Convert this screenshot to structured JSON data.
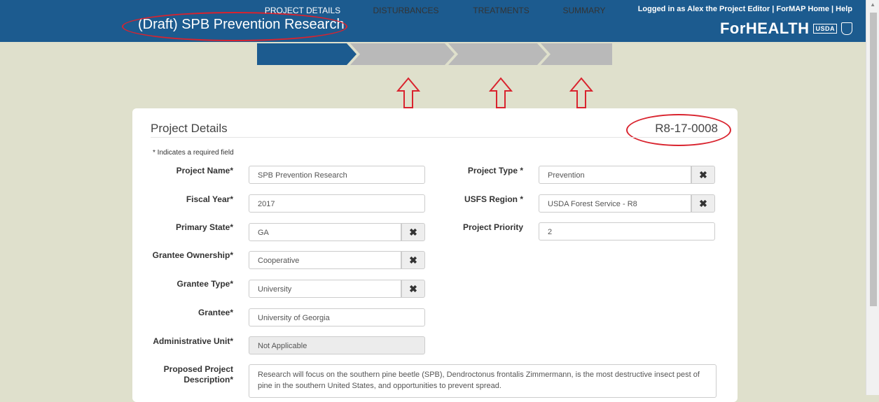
{
  "header": {
    "title": "(Draft) SPB Prevention Research",
    "logged_in": "Logged in as Alex the Project Editor",
    "link_home": "ForMAP Home",
    "link_help": "Help",
    "sep": "|",
    "brand": "ForHEALTH",
    "usda_mark": "USDA"
  },
  "wizard": {
    "steps": [
      {
        "label": "PROJECT DETAILS",
        "active": true
      },
      {
        "label": "DISTURBANCES",
        "active": false
      },
      {
        "label": "TREATMENTS",
        "active": false
      },
      {
        "label": "SUMMARY",
        "active": false
      }
    ]
  },
  "card": {
    "title": "Project Details",
    "project_id": "R8-17-0008",
    "required_note": "* Indicates a required field"
  },
  "form": {
    "project_name": {
      "label": "Project Name*",
      "value": "SPB Prevention Research"
    },
    "fiscal_year": {
      "label": "Fiscal Year*",
      "value": "2017"
    },
    "primary_state": {
      "label": "Primary State*",
      "value": "GA"
    },
    "grantee_ownership": {
      "label": "Grantee Ownership*",
      "value": "Cooperative"
    },
    "grantee_type": {
      "label": "Grantee Type*",
      "value": "University"
    },
    "grantee": {
      "label": "Grantee*",
      "value": "University of Georgia"
    },
    "admin_unit": {
      "label": "Administrative Unit*",
      "value": "Not Applicable"
    },
    "description": {
      "label_line1": "Proposed Project",
      "label_line2": "Description*",
      "value": "Research will focus on the southern pine beetle (SPB), Dendroctonus frontalis Zimmermann, is the most destructive insect pest of pine in the southern United States, and opportunities to prevent spread."
    },
    "project_type": {
      "label": "Project Type *",
      "value": "Prevention"
    },
    "usfs_region": {
      "label": "USFS Region *",
      "value": "USDA Forest Service - R8"
    },
    "project_priority": {
      "label": "Project Priority",
      "value": "2"
    },
    "clear_glyph": "✖"
  },
  "colors": {
    "header": "#1c5b8f",
    "background": "#dfe0cc",
    "annotation": "#d9232e",
    "step_inactive": "#b9b9b9"
  }
}
